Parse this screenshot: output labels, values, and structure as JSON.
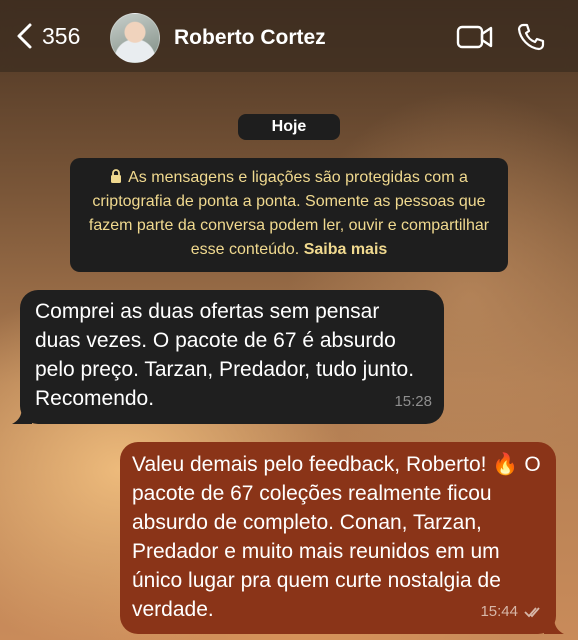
{
  "header": {
    "back_count": "356",
    "contact_name": "Roberto Cortez",
    "icons": {
      "back": "chevron-left-icon",
      "video": "video-camera-icon",
      "call": "phone-icon"
    }
  },
  "chat": {
    "date_label": "Hoje",
    "encryption_notice": {
      "text": "As mensagens e ligações são protegidas com a criptografia de ponta a ponta. Somente as pessoas que fazem parte da conversa podem ler, ouvir e compartilhar esse conteúdo.",
      "link": "Saiba mais"
    },
    "messages": [
      {
        "direction": "incoming",
        "text": "Comprei as duas ofertas sem pensar duas vezes. O pacote de 67 é absurdo pelo preço. Tarzan, Predador, tudo junto. Recomendo.",
        "time": "15:28"
      },
      {
        "direction": "outgoing",
        "text": "Valeu demais pelo feedback, Roberto! 🔥 O pacote de 67 coleções realmente ficou absurdo de completo. Conan, Tarzan, Predador e muito mais reunidos em um único lugar pra quem curte nostalgia de verdade.",
        "time": "15:44",
        "status": "read"
      }
    ]
  },
  "colors": {
    "incoming_bubble": "#1f1f1f",
    "outgoing_bubble": "#8a3418",
    "notice_text": "#f0d98f"
  }
}
